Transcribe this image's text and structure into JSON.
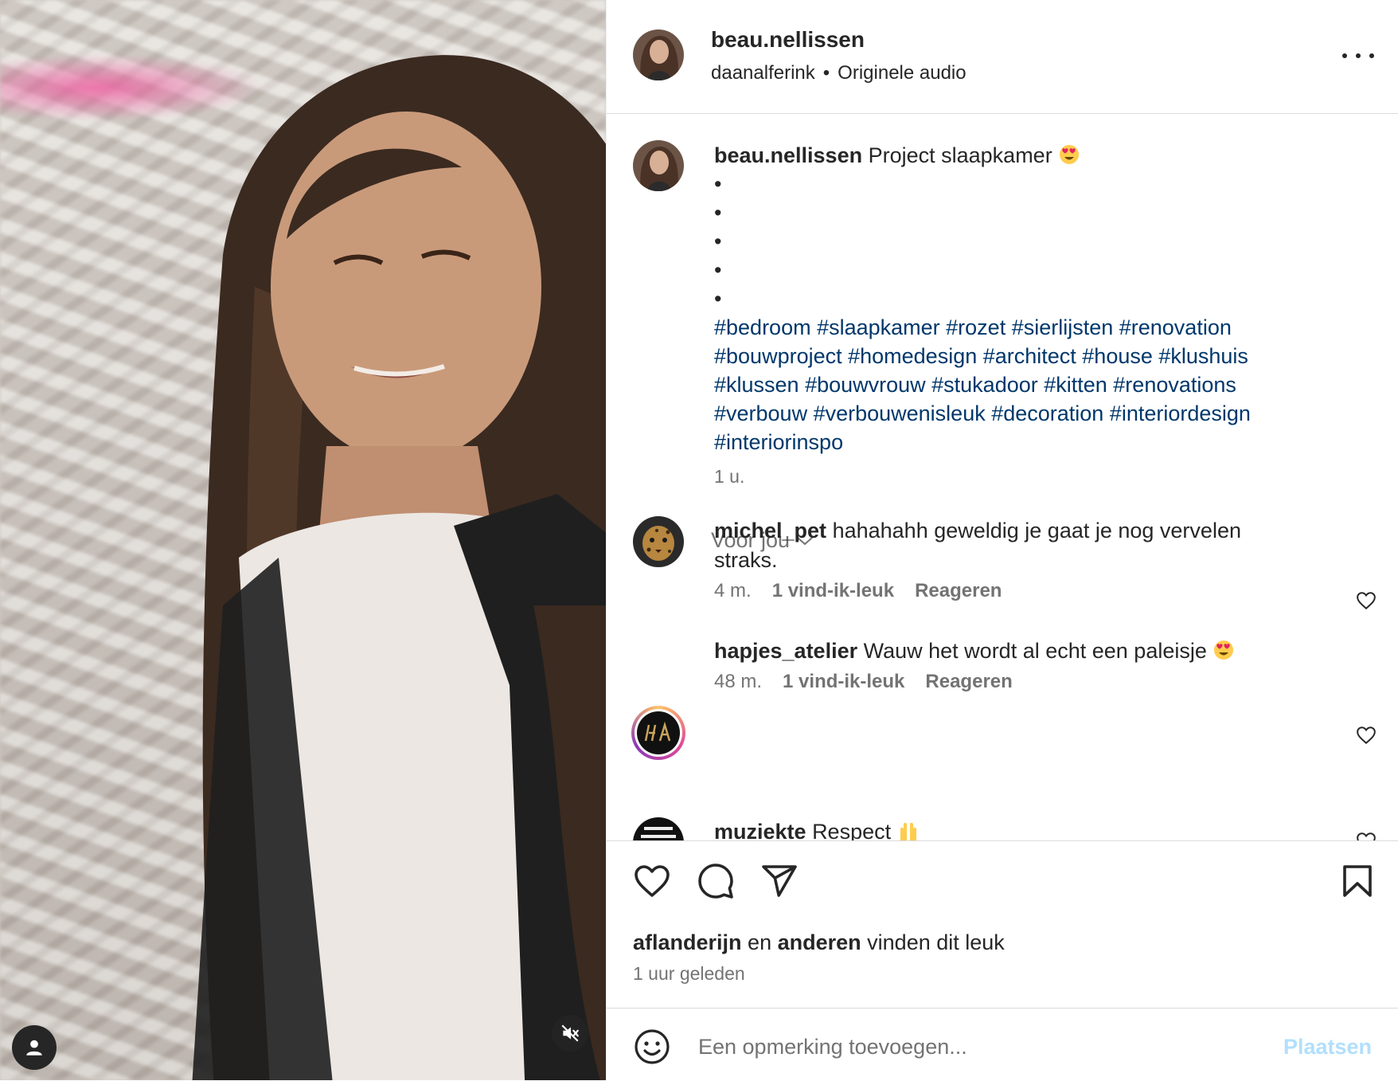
{
  "post": {
    "username": "beau.nellissen",
    "audio_artist": "daanalferink",
    "separator": "•",
    "audio_label": "Originele audio"
  },
  "caption": {
    "username": "beau.nellissen",
    "text": "Project slaapkamer",
    "bullets": [
      "•",
      "•",
      "•",
      "•",
      "•"
    ],
    "hashtags": "#bedroom #slaapkamer #rozet #sierlijsten #renovation #bouwproject #homedesign #architect #house #klushuis #klussen #bouwvrouw #stukadoor #kitten #renovations #verbouw #verbouwenisleuk #decoration #interiordesign #interiorinspo",
    "time": "1 u."
  },
  "for_you": {
    "label": "Voor jou"
  },
  "comments": [
    {
      "username": "michel_pet",
      "text": "hahahahh geweldig je gaat je nog vervelen straks.",
      "time": "4 m.",
      "likes": "1 vind-ik-leuk",
      "reply": "Reageren"
    },
    {
      "username": "hapjes_atelier",
      "text": "Wauw het wordt al echt een paleisje",
      "time": "48 m.",
      "likes": "1 vind-ik-leuk",
      "reply": "Reageren"
    },
    {
      "username": "muziekte",
      "text": "Respect"
    }
  ],
  "likes_line": {
    "user": "aflanderijn",
    "middle": "en",
    "others": "anderen",
    "suffix": "vinden dit leuk"
  },
  "posted_ago": "1 uur geleden",
  "composer": {
    "placeholder": "Een opmerking toevoegen...",
    "post_label": "Plaatsen"
  },
  "colors": {
    "hashtag": "#00376b",
    "muted": "#737373",
    "post_disabled": "#b2dffc",
    "border": "#dbdbdb"
  }
}
